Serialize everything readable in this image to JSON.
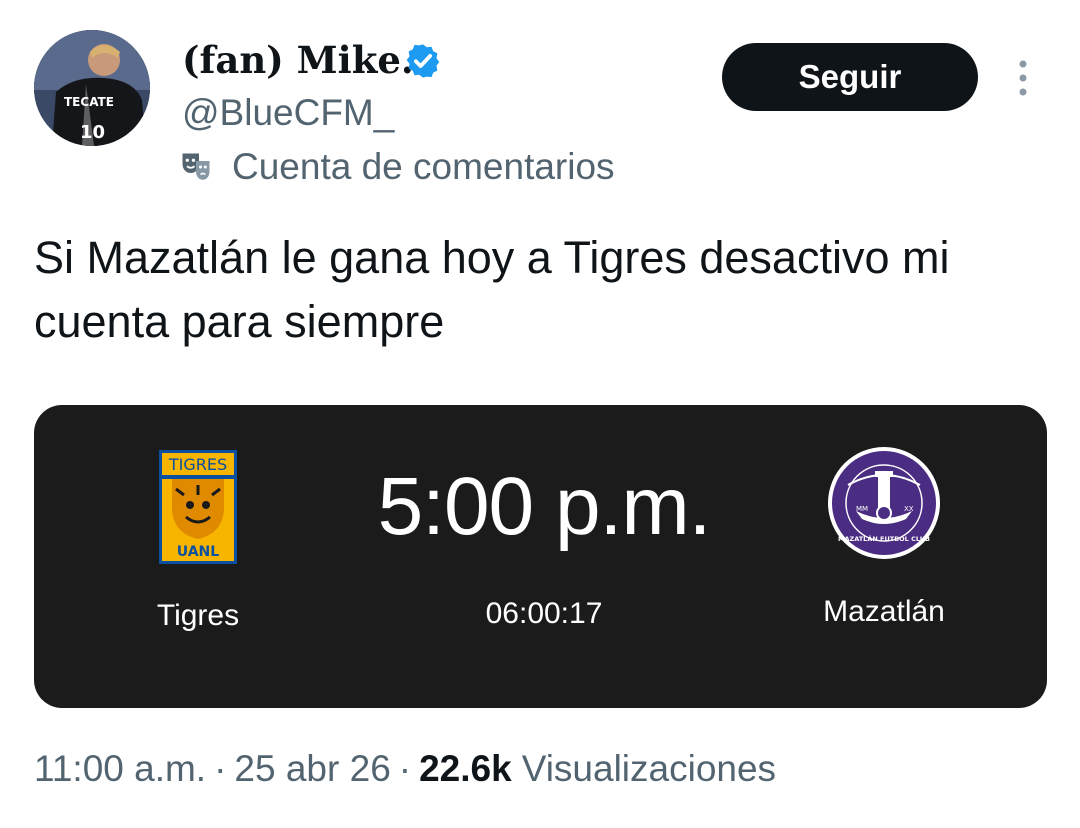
{
  "author": {
    "display_name": "(fan) Mike.",
    "handle": "@BlueCFM_",
    "account_label": "Cuenta de comentarios",
    "avatar_icon": "player-photo-avatar",
    "verified_icon": "verified-badge-icon",
    "verified_color": "#1d9bf0"
  },
  "actions": {
    "follow_label": "Seguir",
    "more_icon": "more-vertical-icon"
  },
  "tweet": {
    "text": "Si Mazatlán le gana hoy a Tigres desactivo mi cuenta para siempre"
  },
  "match_card": {
    "home_team": "Tigres",
    "home_logo_text_top": "TIGRES",
    "home_logo_text_bottom": "UANL",
    "away_team": "Mazatlán",
    "away_logo_text": "MAZATLÁN FUTBOL CLUB",
    "time": "5:00 p.m.",
    "countdown": "06:00:17",
    "card_color": "#1b1b1b"
  },
  "meta": {
    "time": "11:00 a.m.",
    "separator": "·",
    "date": "25 abr 26",
    "views_count": "22.6k",
    "views_label": "Visualizaciones"
  }
}
